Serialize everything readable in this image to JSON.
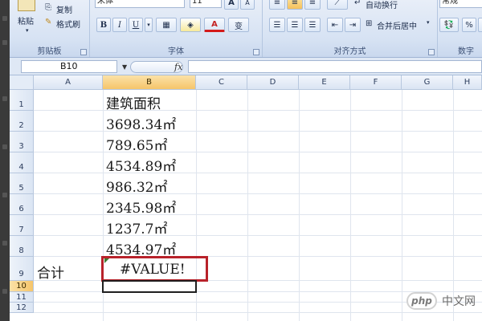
{
  "ribbon": {
    "clipboard": {
      "label": "剪贴板",
      "paste": "粘贴",
      "copy": "复制",
      "format_painter": "格式刷"
    },
    "font": {
      "label": "字体",
      "font_name": "宋体",
      "font_size": "11",
      "bold": "B",
      "italic": "I",
      "underline": "U",
      "grow": "A",
      "shrink": "A",
      "phonetic": "变"
    },
    "alignment": {
      "label": "对齐方式",
      "wrap_text": "自动换行",
      "merge_center": "合并后居中"
    },
    "number": {
      "label": "数字",
      "format": "常规",
      "percent": "%"
    }
  },
  "formula_bar": {
    "name_box": "B10",
    "fx": "fx",
    "formula": ""
  },
  "sheet": {
    "columns": [
      "A",
      "B",
      "C",
      "D",
      "E",
      "F",
      "G",
      "H"
    ],
    "rows": [
      "1",
      "2",
      "3",
      "4",
      "5",
      "6",
      "7",
      "8",
      "9",
      "10",
      "11",
      "12"
    ],
    "cells": {
      "b1": "建筑面积",
      "b2": "3698.34㎡",
      "b3": "789.65㎡",
      "b4": "4534.89㎡",
      "b5": "986.32㎡",
      "b6": "2345.98㎡",
      "b7": "1237.7㎡",
      "b8": "4534.97㎡",
      "a9": "合计",
      "b9": "#VALUE!"
    },
    "selected_cell": "B10"
  },
  "watermark": {
    "badge": "php",
    "text": "中文网"
  },
  "colors": {
    "highlight_border": "#b8222a",
    "header_selected": "#f6c56a"
  }
}
